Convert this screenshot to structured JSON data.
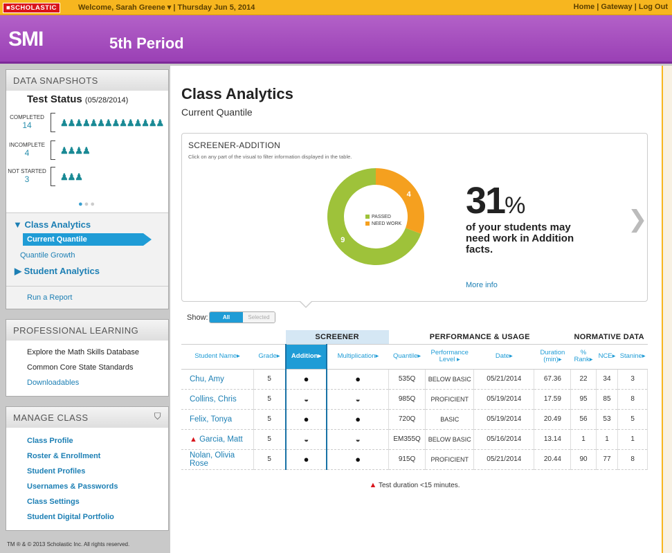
{
  "topbar": {
    "logo": "■SCHOLASTIC",
    "welcome": "Welcome, Sarah Greene ▾  |  Thursday Jun 5, 2014",
    "links": "Home  |  Gateway  |  Log Out"
  },
  "header": {
    "app": "SMI",
    "period": "5th Period"
  },
  "snapshots": {
    "title": "DATA SNAPSHOTS",
    "test_status": "Test Status",
    "test_date": "(05/28/2014)",
    "rows": [
      {
        "label": "COMPLETED",
        "count": "14",
        "icons": "ꜜꜜꜜꜜꜜꜜꜜꜜꜜꜜꜜꜜꜜꜜ"
      },
      {
        "label": "INCOMPLETE",
        "count": "4",
        "icons": "ꜜꜜꜜꜜ"
      },
      {
        "label": "NOT STARTED",
        "count": "3",
        "icons": "ꜜꜜꜜ"
      }
    ]
  },
  "nav": {
    "class_analytics": "▼  Class Analytics",
    "current_quantile": "Current Quantile",
    "quantile_growth": "Quantile Growth",
    "student_analytics": "▶  Student Analytics",
    "run_report": "Run a Report"
  },
  "professional": {
    "title": "PROFESSIONAL LEARNING",
    "items": [
      "Explore the Math Skills Database",
      "Common Core State Standards",
      "Downloadables"
    ]
  },
  "manage": {
    "title": "MANAGE CLASS",
    "items": [
      "Class Profile",
      "Roster & Enrollment",
      "Student Profiles",
      "Usernames & Passwords",
      "Class Settings",
      "Student Digital Portfolio"
    ]
  },
  "copyright": "TM ® & © 2013 Scholastic Inc. All rights reserved.",
  "main": {
    "title": "Class Analytics",
    "subtitle": "Current Quantile",
    "screener_title": "SCREENER-ADDITION",
    "instruction": "Click on any part of the visual to filter information displayed in the table.",
    "percent": "31",
    "percent_sign": "%",
    "statement": "of your students may need work in Addition facts.",
    "more_info": "More info",
    "legend_passed": "PASSED",
    "legend_need": "NEED WORK",
    "show_label": "Show:",
    "toggle_all": "All",
    "toggle_selected": "Selected",
    "footnote": "Test duration <15 minutes."
  },
  "chart_data": {
    "type": "pie",
    "categories": [
      "PASSED",
      "NEED WORK"
    ],
    "values": [
      9,
      4
    ],
    "colors": [
      "#9ec23a",
      "#f5a01f"
    ],
    "donut": true
  },
  "table": {
    "groups": {
      "screener": "SCREENER",
      "performance": "PERFORMANCE & USAGE",
      "normative": "NORMATIVE DATA"
    },
    "columns": {
      "name": "Student Name▸",
      "grade": "Grade▸",
      "addition": "Addition▸",
      "multiplication": "Multiplication▸",
      "quantile": "Quantile▸",
      "perf": "Performance Level ▸",
      "date": "Date▸",
      "duration": "Duration (min)▸",
      "rank": "% Rank▸",
      "nce": "NCE▸",
      "stanine": "Stanine▸"
    },
    "rows": [
      {
        "name": "Chu, Amy",
        "grade": "5",
        "add": "●",
        "mult": "●",
        "quantile": "535Q",
        "level": "BELOW BASIC",
        "date": "05/21/2014",
        "duration": "67.36",
        "rank": "22",
        "nce": "34",
        "stanine": "3",
        "warn": ""
      },
      {
        "name": "Collins, Chris",
        "grade": "5",
        "add": "◒",
        "mult": "◒",
        "quantile": "985Q",
        "level": "PROFICIENT",
        "date": "05/19/2014",
        "duration": "17.59",
        "rank": "95",
        "nce": "85",
        "stanine": "8",
        "warn": ""
      },
      {
        "name": "Felix, Tonya",
        "grade": "5",
        "add": "●",
        "mult": "●",
        "quantile": "720Q",
        "level": "BASIC",
        "date": "05/19/2014",
        "duration": "20.49",
        "rank": "56",
        "nce": "53",
        "stanine": "5",
        "warn": ""
      },
      {
        "name": "Garcia, Matt",
        "grade": "5",
        "add": "◒",
        "mult": "◒",
        "quantile": "EM355Q",
        "level": "BELOW BASIC",
        "date": "05/16/2014",
        "duration": "13.14",
        "rank": "1",
        "nce": "1",
        "stanine": "1",
        "warn": "▲"
      },
      {
        "name": "Nolan, Olivia Rose",
        "grade": "5",
        "add": "●",
        "mult": "●",
        "quantile": "915Q",
        "level": "PROFICIENT",
        "date": "05/21/2014",
        "duration": "20.44",
        "rank": "90",
        "nce": "77",
        "stanine": "8",
        "warn": ""
      }
    ]
  }
}
